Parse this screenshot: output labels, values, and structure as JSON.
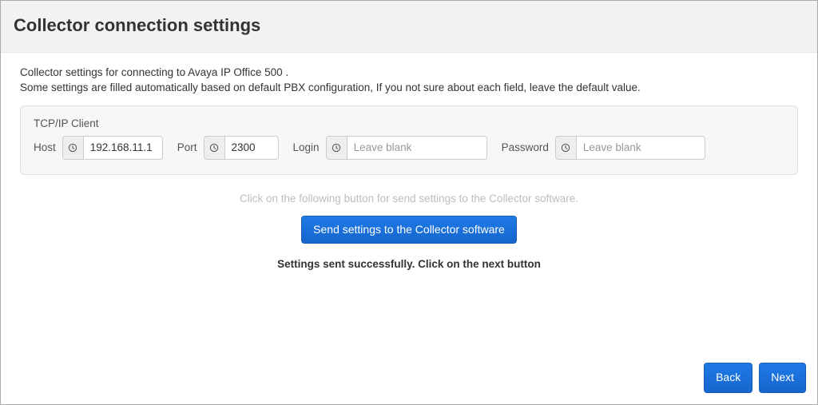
{
  "header": {
    "title": "Collector connection settings"
  },
  "intro": {
    "line1": "Collector settings for connecting to Avaya IP Office 500 .",
    "line2": "Some settings are filled automatically based on default PBX configuration, If you not sure about each field, leave the default value."
  },
  "panel": {
    "title": "TCP/IP Client",
    "host": {
      "label": "Host",
      "value": "192.168.11.1"
    },
    "port": {
      "label": "Port",
      "value": "2300"
    },
    "login": {
      "label": "Login",
      "placeholder": "Leave blank",
      "value": ""
    },
    "password": {
      "label": "Password",
      "placeholder": "Leave blank",
      "value": ""
    }
  },
  "hint": "Click on the following button for send settings to the Collector software.",
  "buttons": {
    "send": "Send settings to the Collector software",
    "back": "Back",
    "next": "Next"
  },
  "status": "Settings sent successfully. Click on the next button"
}
